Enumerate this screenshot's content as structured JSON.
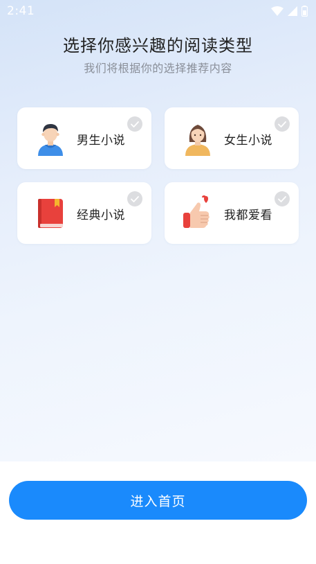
{
  "status_bar": {
    "time": "2:41",
    "icons": [
      "wifi-icon",
      "cell-signal-icon",
      "battery-icon"
    ]
  },
  "header": {
    "title": "选择你感兴趣的阅读类型",
    "subtitle": "我们将根据你的选择推荐内容"
  },
  "options": [
    {
      "label": "男生小说",
      "icon": "male-avatar-icon",
      "selected": false
    },
    {
      "label": "女生小说",
      "icon": "female-avatar-icon",
      "selected": false
    },
    {
      "label": "经典小说",
      "icon": "book-icon",
      "selected": false
    },
    {
      "label": "我都爱看",
      "icon": "thumbs-up-heart-icon",
      "selected": false
    }
  ],
  "enter_button": {
    "label": "进入首页"
  },
  "colors": {
    "accent": "#1a8afc",
    "check_unselected": "#dcdde0",
    "title": "#222222",
    "subtitle": "#8a8f99"
  }
}
